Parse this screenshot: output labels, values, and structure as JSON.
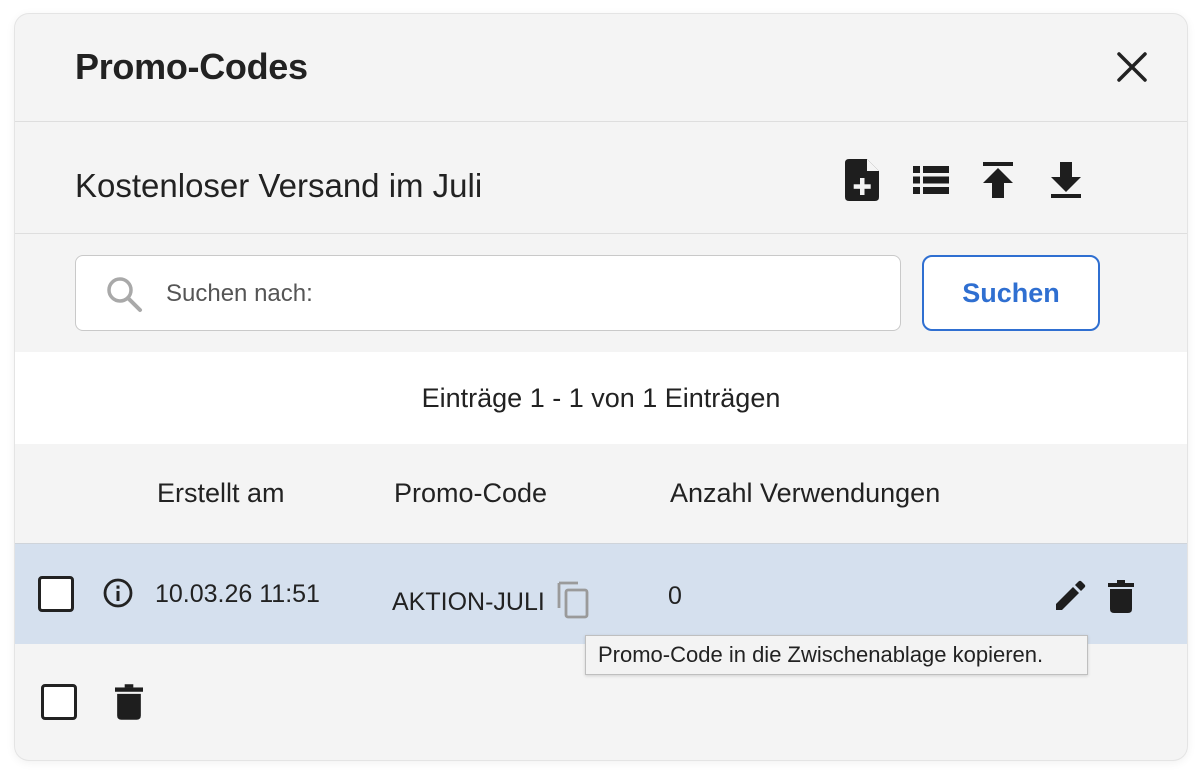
{
  "dialog": {
    "title": "Promo-Codes",
    "close_icon": "close-icon"
  },
  "campaign": {
    "name": "Kostenloser Versand im Juli",
    "toolbar": [
      {
        "name": "add-document-icon"
      },
      {
        "name": "list-icon"
      },
      {
        "name": "upload-icon"
      },
      {
        "name": "download-icon"
      }
    ]
  },
  "search": {
    "placeholder": "Suchen nach:",
    "value": "",
    "button_label": "Suchen",
    "icon": "search-icon"
  },
  "pagination": {
    "summary": "Einträge 1 - 1 von 1 Einträgen"
  },
  "table": {
    "columns": [
      "Erstellt am",
      "Promo-Code",
      "Anzahl Verwendungen"
    ],
    "rows": [
      {
        "created": "10.03.26 11:51",
        "code": "AKTION-JULI",
        "uses": "0",
        "selected": false
      }
    ]
  },
  "tooltip": {
    "text": "Promo-Code in die Zwischenablage kopieren."
  },
  "colors": {
    "accent": "#2f6fd1",
    "row_highlight": "#d5e0ee",
    "panel": "#f4f4f4"
  }
}
